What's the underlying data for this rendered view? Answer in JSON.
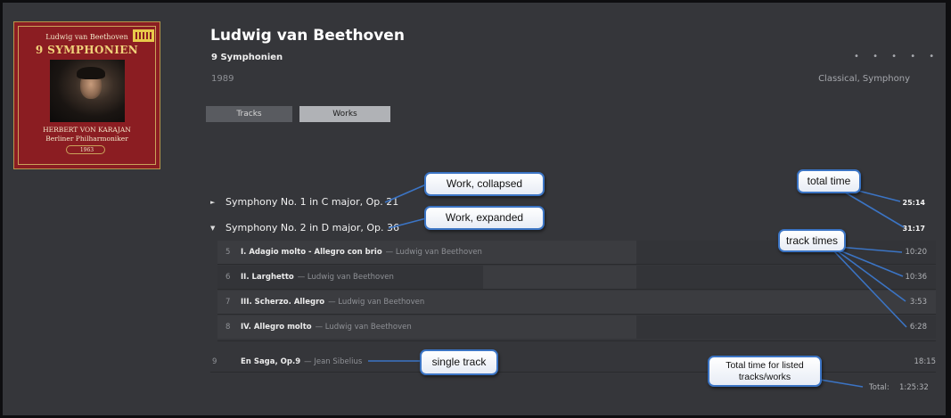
{
  "album": {
    "artist": "Ludwig van Beethoven",
    "title": "9 Symphonien",
    "year": "1989",
    "genre": "Classical, Symphony",
    "rating_dots": "• • • • •"
  },
  "cover": {
    "composer": "Ludwig van Beethoven",
    "title": "9 SYMPHONIEN",
    "artist_line1": "HERBERT VON KARAJAN",
    "artist_line2": "Berliner Philharmoniker",
    "year": "1963"
  },
  "tabs": {
    "tracks": "Tracks",
    "works": "Works",
    "active": "works"
  },
  "works": [
    {
      "caret": "►",
      "title": "Symphony No. 1 in C major, Op. 21",
      "time": "25:14",
      "expanded": false
    },
    {
      "caret": "▼",
      "title": "Symphony No. 2 in D major, Op. 36",
      "time": "31:17",
      "expanded": true
    }
  ],
  "tracks": [
    {
      "num": "5",
      "title": "I. Adagio molto - Allegro con brio",
      "artist": "— Ludwig van Beethoven",
      "time": "10:20"
    },
    {
      "num": "6",
      "title": "II. Larghetto",
      "artist": "— Ludwig van Beethoven",
      "time": "10:36"
    },
    {
      "num": "7",
      "title": "III. Scherzo. Allegro",
      "artist": "— Ludwig van Beethoven",
      "time": "3:53"
    },
    {
      "num": "8",
      "title": "IV. Allegro molto",
      "artist": "— Ludwig van Beethoven",
      "time": "6:28"
    }
  ],
  "single_track": {
    "num": "9",
    "title": "En Saga, Op.9",
    "artist": "— Jean Sibelius",
    "time": "18:15"
  },
  "total": {
    "label": "Total:",
    "value": "1:25:32"
  },
  "callouts": {
    "work_collapsed": "Work, collapsed",
    "work_expanded": "Work, expanded",
    "total_time": "total time",
    "track_times": "track times",
    "single_track": "single track",
    "total_listed_line1": "Total time for listed",
    "total_listed_line2": "tracks/works"
  },
  "colors": {
    "background": "#35363a",
    "callout_border": "#3b74c4",
    "cover_red": "#8b1d22"
  }
}
